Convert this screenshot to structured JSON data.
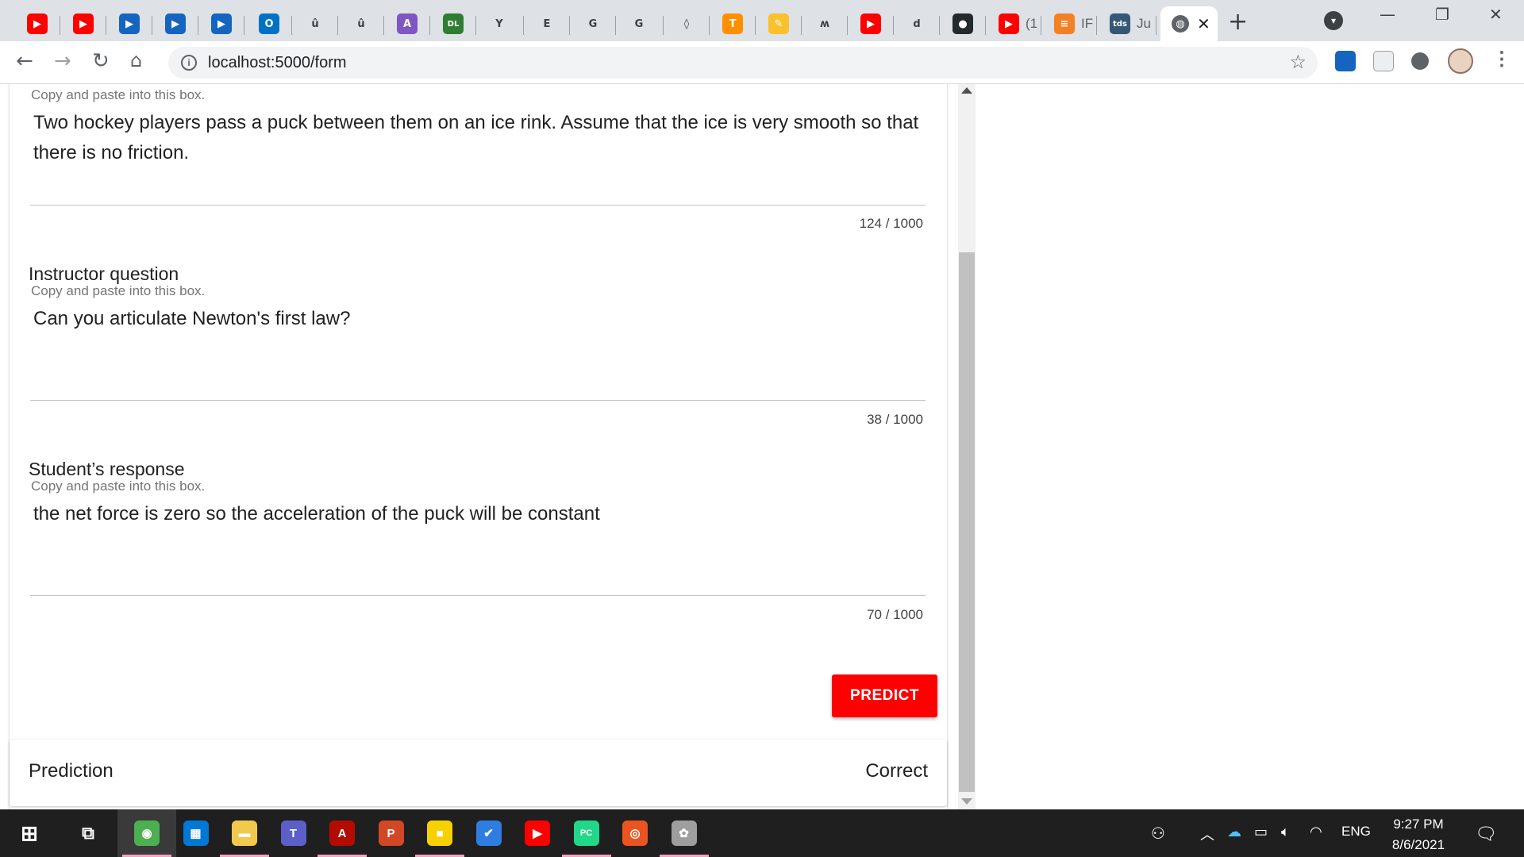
{
  "browser": {
    "tabs": [
      {
        "icon": "youtube-icon",
        "color": "#ff0000",
        "glyph": "▶",
        "label": ""
      },
      {
        "icon": "youtube-icon",
        "color": "#ff0000",
        "glyph": "▶",
        "label": ""
      },
      {
        "icon": "play-icon",
        "color": "#1565c0",
        "glyph": "▶",
        "label": ""
      },
      {
        "icon": "play-icon",
        "color": "#1565c0",
        "glyph": "▶",
        "label": ""
      },
      {
        "icon": "play-icon",
        "color": "#1565c0",
        "glyph": "▶",
        "label": ""
      },
      {
        "icon": "outlook-icon",
        "color": "#0072c6",
        "glyph": "O",
        "label": ""
      },
      {
        "icon": "u-icon",
        "color": "#ffffff",
        "glyph": "û",
        "label": ""
      },
      {
        "icon": "u-icon",
        "color": "#ffffff",
        "glyph": "û",
        "label": ""
      },
      {
        "icon": "a-icon",
        "color": "#7e57c2",
        "glyph": "A",
        "label": ""
      },
      {
        "icon": "dl-icon",
        "color": "#2e7d32",
        "glyph": "DL",
        "label": ""
      },
      {
        "icon": "y-icon",
        "color": "#ffffff",
        "glyph": "Y",
        "label": ""
      },
      {
        "icon": "doc-icon",
        "color": "#ffffff",
        "glyph": "E",
        "label": ""
      },
      {
        "icon": "google-icon",
        "color": "#ffffff",
        "glyph": "G",
        "label": ""
      },
      {
        "icon": "google-icon",
        "color": "#ffffff",
        "glyph": "G",
        "label": ""
      },
      {
        "icon": "diamond-icon",
        "color": "#ffffff",
        "glyph": "◊",
        "label": ""
      },
      {
        "icon": "tensorflow-icon",
        "color": "#ff8f00",
        "glyph": "T",
        "label": ""
      },
      {
        "icon": "note-icon",
        "color": "#fbc02d",
        "glyph": "✎",
        "label": ""
      },
      {
        "icon": "wave-icon",
        "color": "#ffffff",
        "glyph": "ʍ",
        "label": ""
      },
      {
        "icon": "youtube-icon",
        "color": "#ff0000",
        "glyph": "▶",
        "label": ""
      },
      {
        "icon": "d-icon",
        "color": "#ffffff",
        "glyph": "d",
        "label": ""
      },
      {
        "icon": "github-icon",
        "color": "#24292e",
        "glyph": "●",
        "label": ""
      },
      {
        "icon": "youtube-icon",
        "color": "#ff0000",
        "glyph": "▶",
        "label": "(1"
      },
      {
        "icon": "stackoverflow-icon",
        "color": "#f48024",
        "glyph": "≡",
        "label": "IF"
      },
      {
        "icon": "tds-icon",
        "color": "#355876",
        "glyph": "tds",
        "label": "Ju"
      }
    ],
    "active_tab_icon": "globe-icon",
    "url": "localhost:5000/form"
  },
  "form": {
    "field1": {
      "hint": "Copy and paste into this box.",
      "value": "Two hockey players pass a puck between them on an ice rink. Assume that the ice is very smooth so that there is no friction.",
      "counter": "124 / 1000"
    },
    "field2": {
      "title": "Instructor question",
      "hint": "Copy and paste into this box.",
      "value": "Can you articulate Newton's first law?",
      "counter": "38 / 1000"
    },
    "field3": {
      "title": "Student’s response",
      "hint": "Copy and paste into this box.",
      "value": "the net force is zero so the acceleration of the puck will be constant",
      "counter": "70 / 1000"
    },
    "predict_label": "PREDICT",
    "accent_color": "#ff0000"
  },
  "result": {
    "label": "Prediction",
    "value": "Correct"
  },
  "taskbar": {
    "apps": [
      {
        "name": "taskbar-chrome",
        "icon": "chrome-icon",
        "color": "#4caf50",
        "glyph": "◉"
      },
      {
        "name": "taskbar-store",
        "icon": "store-icon",
        "color": "#0078d4",
        "glyph": "▦"
      },
      {
        "name": "taskbar-explorer",
        "icon": "folder-icon",
        "color": "#f2c94c",
        "glyph": "▬"
      },
      {
        "name": "taskbar-teams",
        "icon": "teams-icon",
        "color": "#5b5fc7",
        "glyph": "T"
      },
      {
        "name": "taskbar-acrobat",
        "icon": "pdf-icon",
        "color": "#b30b00",
        "glyph": "A"
      },
      {
        "name": "taskbar-powerpoint",
        "icon": "powerpoint-icon",
        "color": "#d24726",
        "glyph": "P"
      },
      {
        "name": "taskbar-sticky-notes",
        "icon": "sticky-notes-icon",
        "color": "#f7d000",
        "glyph": "■"
      },
      {
        "name": "taskbar-todo",
        "icon": "todo-icon",
        "color": "#2f7de1",
        "glyph": "✔"
      },
      {
        "name": "taskbar-youtube",
        "icon": "youtube-icon",
        "color": "#ff0000",
        "glyph": "▶"
      },
      {
        "name": "taskbar-pycharm",
        "icon": "pycharm-icon",
        "color": "#21d789",
        "glyph": "PC"
      },
      {
        "name": "taskbar-ubuntu",
        "icon": "ubuntu-icon",
        "color": "#e95420",
        "glyph": "◎"
      },
      {
        "name": "taskbar-paint",
        "icon": "paint-icon",
        "color": "#9e9e9e",
        "glyph": "✿"
      }
    ],
    "language": "ENG",
    "time": "9:27 PM",
    "date": "8/6/2021"
  }
}
